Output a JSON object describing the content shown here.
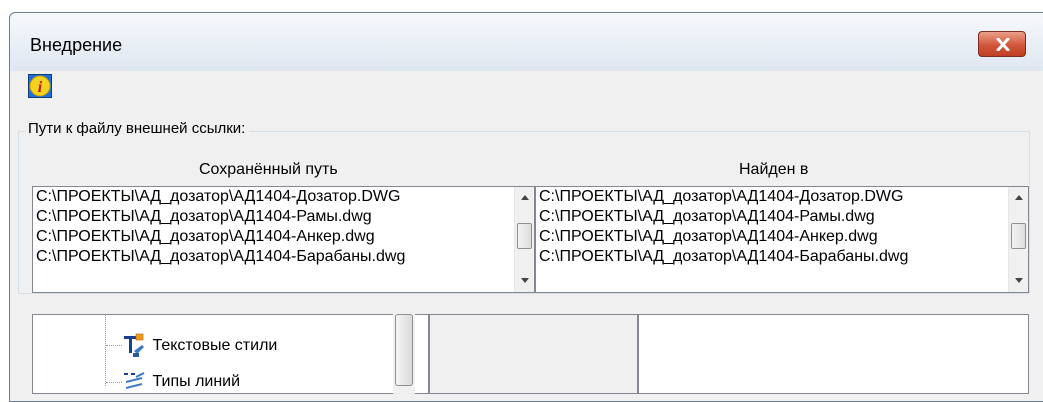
{
  "window": {
    "title": "Внедрение"
  },
  "group": {
    "label": "Пути к файлу внешней ссылки:"
  },
  "columns": {
    "saved_header": "Сохранённый путь",
    "found_header": "Найден в"
  },
  "saved_paths": [
    "C:\\ПРОЕКТЫ\\АД_дозатор\\АД1404-Дозатор.DWG",
    "C:\\ПРОЕКТЫ\\АД_дозатор\\АД1404-Рамы.dwg",
    "C:\\ПРОЕКТЫ\\АД_дозатор\\АД1404-Анкер.dwg",
    "C:\\ПРОЕКТЫ\\АД_дозатор\\АД1404-Барабаны.dwg"
  ],
  "found_paths": [
    "C:\\ПРОЕКТЫ\\АД_дозатор\\АД1404-Дозатор.DWG",
    "C:\\ПРОЕКТЫ\\АД_дозатор\\АД1404-Рамы.dwg",
    "C:\\ПРОЕКТЫ\\АД_дозатор\\АД1404-Анкер.dwg",
    "C:\\ПРОЕКТЫ\\АД_дозатор\\АД1404-Барабаны.dwg"
  ],
  "tree": {
    "items": [
      {
        "label": "Текстовые стили",
        "icon": "text-style-icon"
      },
      {
        "label": "Типы линий",
        "icon": "linetype-icon"
      }
    ]
  },
  "colors": {
    "close_button": "#c9472d",
    "info_icon_bg": "#1e6fd9",
    "info_icon_fg": "#f4d21e"
  }
}
